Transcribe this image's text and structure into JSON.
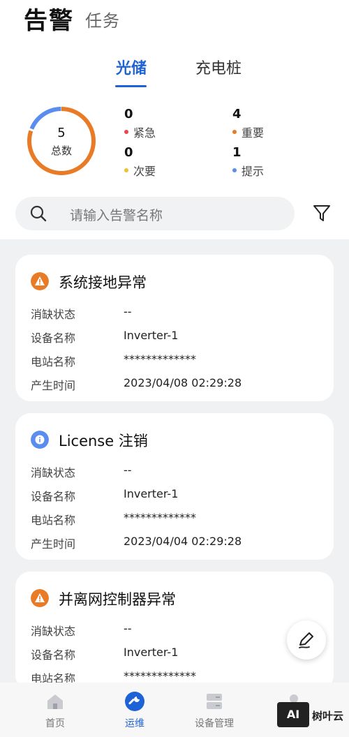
{
  "header": {
    "title": "告警",
    "secondary_tab": "任务"
  },
  "segments": [
    {
      "label": "光储",
      "active": true
    },
    {
      "label": "充电桩",
      "active": false
    }
  ],
  "summary": {
    "total": "5",
    "total_label": "总数",
    "stats": [
      {
        "count": "0",
        "label": "紧急",
        "color": "#e5484d"
      },
      {
        "count": "4",
        "label": "重要",
        "color": "#ea7b26"
      },
      {
        "count": "0",
        "label": "次要",
        "color": "#f2c029"
      },
      {
        "count": "1",
        "label": "提示",
        "color": "#5b8def"
      }
    ]
  },
  "search": {
    "placeholder": "请输入告警名称"
  },
  "alarms": [
    {
      "title": "系统接地异常",
      "severity_icon": "warning-icon",
      "color": "#ea7b26",
      "rows": [
        {
          "label": "消缺状态",
          "value": "--"
        },
        {
          "label": "设备名称",
          "value": "Inverter-1"
        },
        {
          "label": "电站名称",
          "value": "*************"
        },
        {
          "label": "产生时间",
          "value": "2023/04/08 02:29:28"
        }
      ]
    },
    {
      "title": "License 注销",
      "severity_icon": "info-icon",
      "color": "#5b8def",
      "rows": [
        {
          "label": "消缺状态",
          "value": "--"
        },
        {
          "label": "设备名称",
          "value": "Inverter-1"
        },
        {
          "label": "电站名称",
          "value": "*************"
        },
        {
          "label": "产生时间",
          "value": "2023/04/04 02:29:28"
        }
      ]
    },
    {
      "title": "并离网控制器异常",
      "severity_icon": "warning-icon",
      "color": "#ea7b26",
      "rows": [
        {
          "label": "消缺状态",
          "value": "--"
        },
        {
          "label": "设备名称",
          "value": "Inverter-1"
        },
        {
          "label": "电站名称",
          "value": "*************"
        }
      ]
    }
  ],
  "bottom_nav": [
    {
      "label": "首页",
      "icon": "home-icon",
      "active": false
    },
    {
      "label": "运维",
      "icon": "wrench-icon",
      "active": true
    },
    {
      "label": "设备管理",
      "icon": "device-icon",
      "active": false
    }
  ],
  "watermark": {
    "box": "AI",
    "text": "树叶云"
  },
  "colors": {
    "accent": "#1e63d6",
    "important": "#ea7b26",
    "hint": "#5b8def"
  }
}
